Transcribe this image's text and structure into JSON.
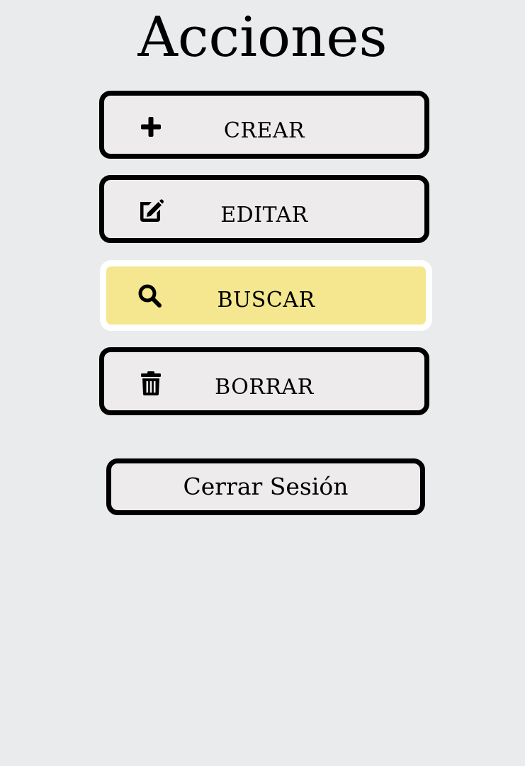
{
  "page": {
    "title": "Acciones"
  },
  "actions": [
    {
      "label": "CREAR",
      "icon": "plus-icon",
      "selected": false
    },
    {
      "label": "EDITAR",
      "icon": "edit-icon",
      "selected": false
    },
    {
      "label": "BUSCAR",
      "icon": "search-icon",
      "selected": true
    },
    {
      "label": "BORRAR",
      "icon": "trash-icon",
      "selected": false
    }
  ],
  "logout": {
    "label": "Cerrar Sesión"
  },
  "colors": {
    "background": "#eaebed",
    "button_background": "#edebec",
    "selected_background": "#f4e78f",
    "selected_border": "#ffffff",
    "border": "#000000"
  }
}
